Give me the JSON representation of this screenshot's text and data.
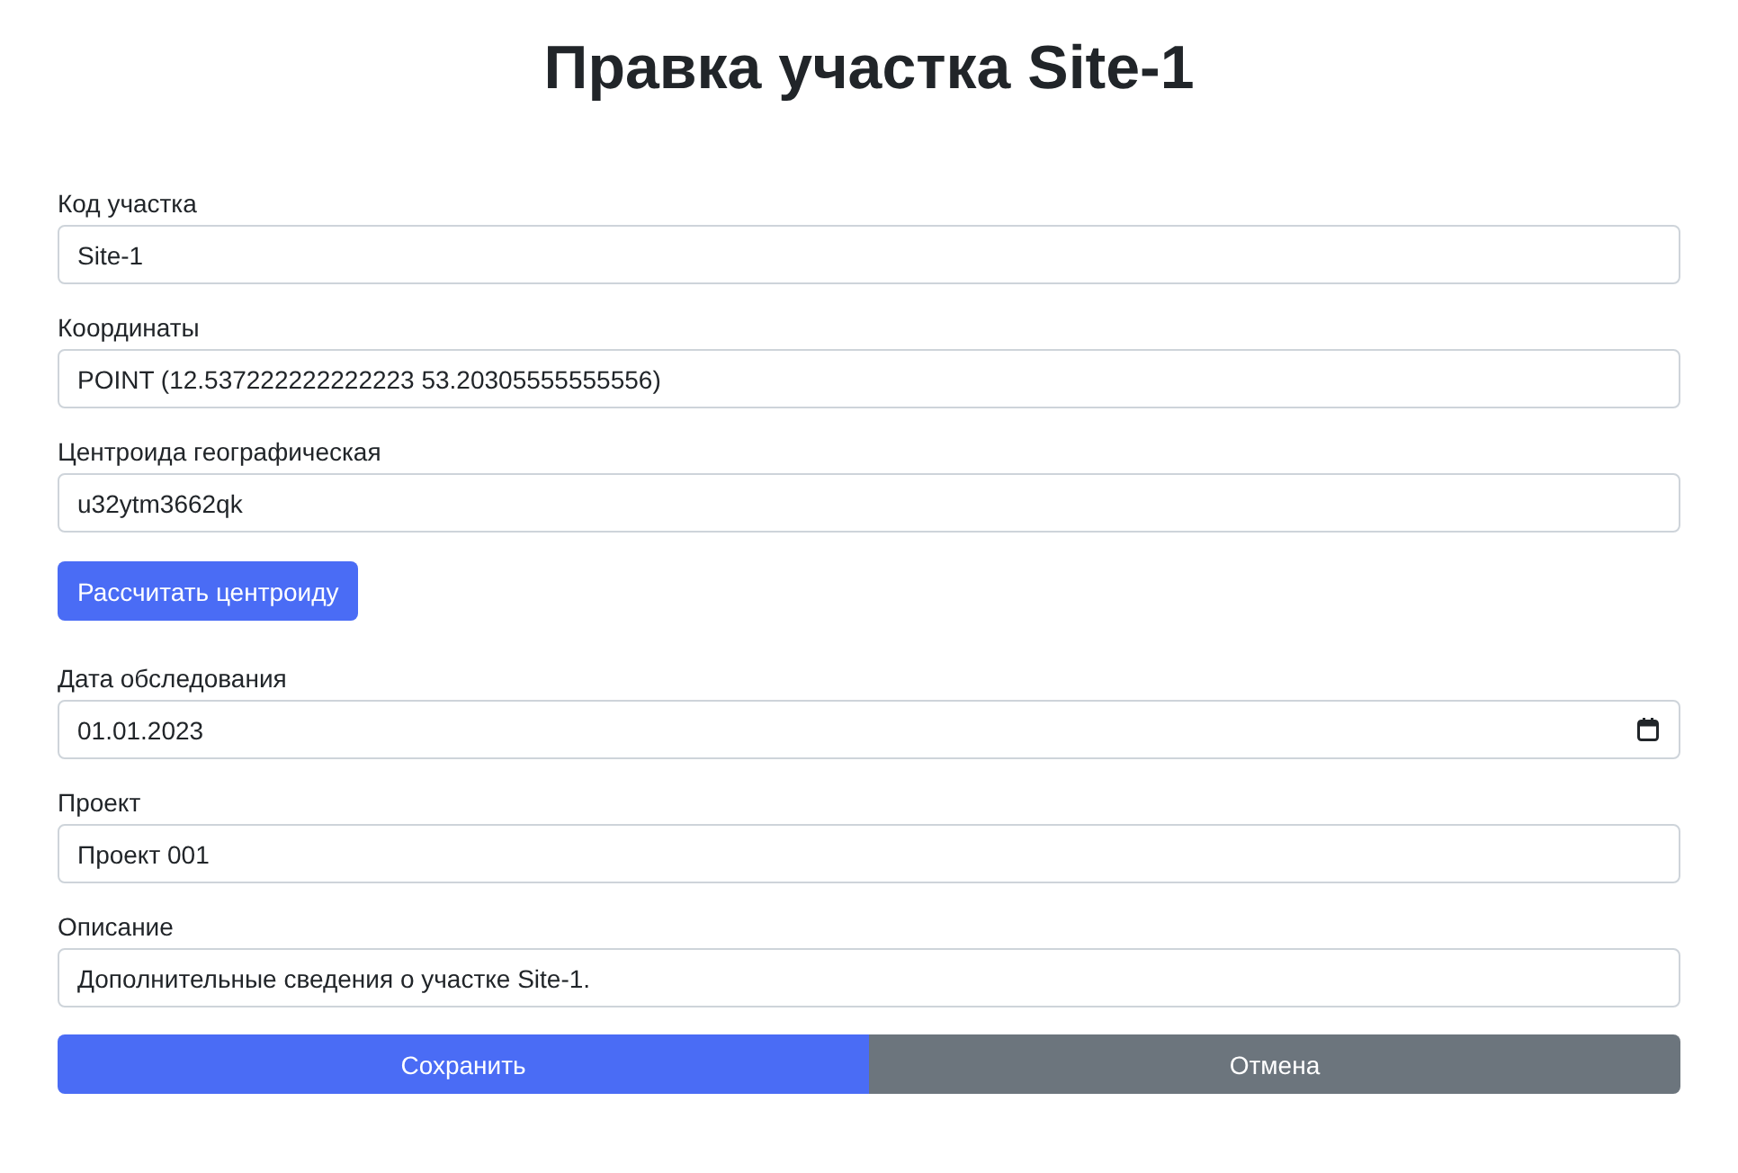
{
  "title": "Правка участка Site-1",
  "items": [
    {
      "kind": "text",
      "label": "Код участка",
      "value": "Site-1"
    },
    {
      "kind": "text",
      "label": "Координаты",
      "value": "POINT (12.537222222222223 53.20305555555556)"
    },
    {
      "kind": "text",
      "label": "Центроида географическая",
      "value": "u32ytm3662qk"
    },
    {
      "kind": "button",
      "label": "Рассчитать центроиду"
    },
    {
      "kind": "date",
      "label": "Дата обследования",
      "value": "01.01.2023"
    },
    {
      "kind": "text",
      "label": "Проект",
      "value": "Проект 001"
    },
    {
      "kind": "text",
      "label": "Описание",
      "value": "Дополнительные сведения о участке Site-1."
    }
  ],
  "actions": [
    {
      "kind": "primary",
      "label": "Сохранить"
    },
    {
      "kind": "secondary",
      "label": "Отмена"
    }
  ]
}
